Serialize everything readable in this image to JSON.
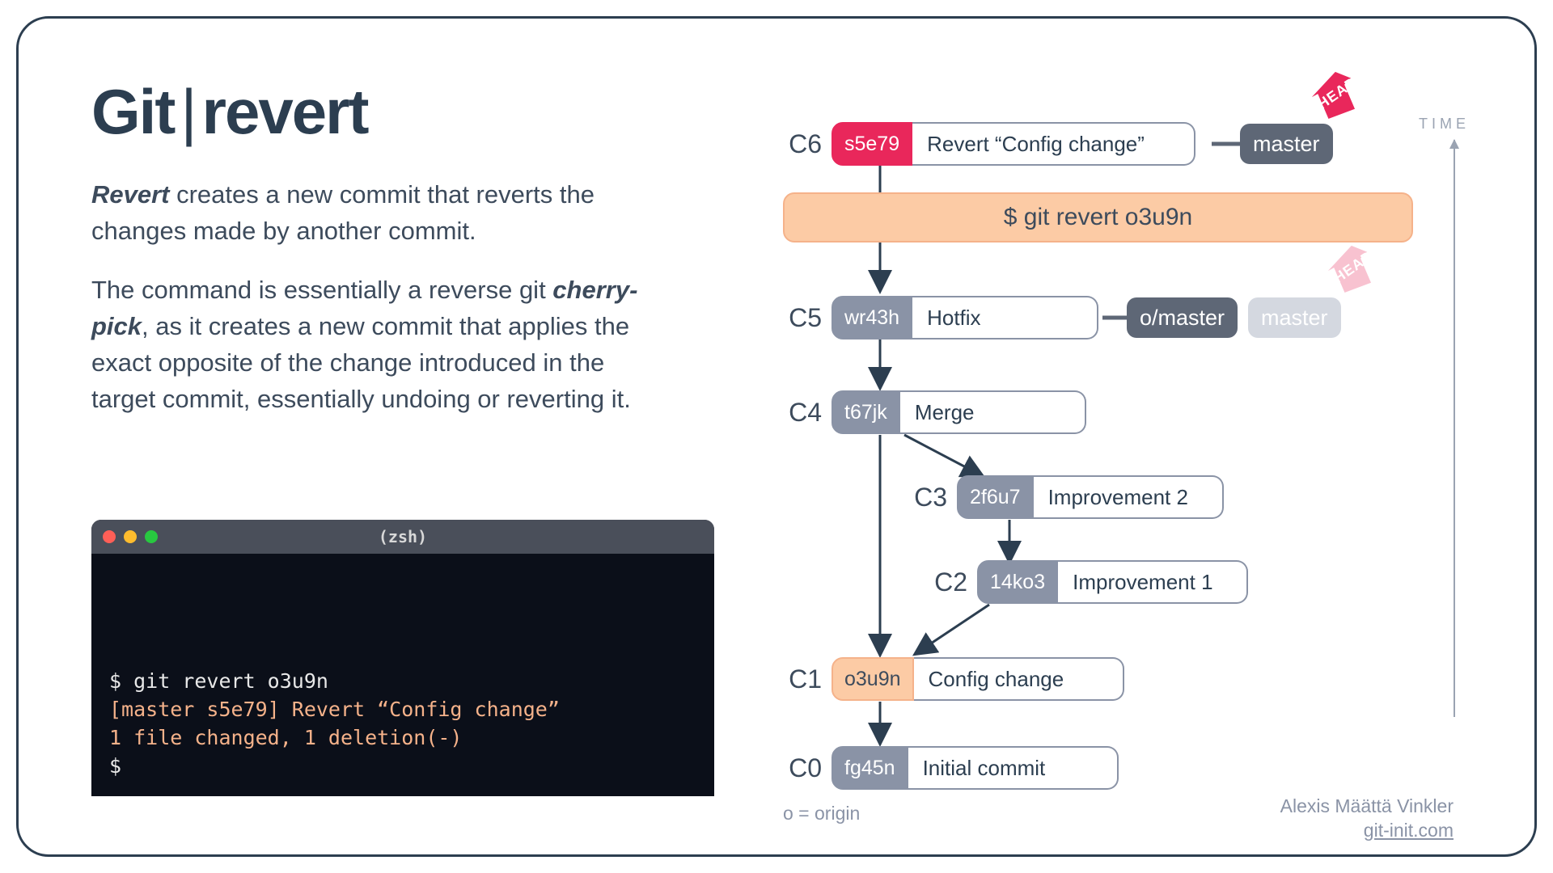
{
  "title_pre": "Git",
  "title_sep": "|",
  "title_post": "revert",
  "desc1_b": "Revert",
  "desc1_rest": " creates a new commit that reverts the changes made by another commit.",
  "desc2_pre": "The command is essentially a reverse git ",
  "desc2_b": "cherry-pick",
  "desc2_rest": ", as it creates a new commit that applies the exact opposite of the change introduced in the target commit, essentially undoing or reverting it.",
  "term_title": "(zsh)",
  "term_l1": "$ git revert o3u9n",
  "term_l2": "[master s5e79] Revert “Config change”",
  "term_l3": "1 file changed, 1 deletion(-)",
  "term_l4": "$",
  "cmd_bar": "$ git revert o3u9n",
  "c6_id": "C6",
  "c6_hash": "s5e79",
  "c6_msg": "Revert “Config change”",
  "c5_id": "C5",
  "c5_hash": "wr43h",
  "c5_msg": "Hotfix",
  "c4_id": "C4",
  "c4_hash": "t67jk",
  "c4_msg": "Merge",
  "c3_id": "C3",
  "c3_hash": "2f6u7",
  "c3_msg": "Improvement 2",
  "c2_id": "C2",
  "c2_hash": "14ko3",
  "c2_msg": "Improvement 1",
  "c1_id": "C1",
  "c1_hash": "o3u9n",
  "c1_msg": "Config change",
  "c0_id": "C0",
  "c0_hash": "fg45n",
  "c0_msg": "Initial commit",
  "ref_master": "master",
  "ref_omaster": "o/master",
  "ref_master_ghost": "master",
  "head": "HEAD",
  "time": "TIME",
  "legend": "o = origin",
  "author": "Alexis Määttä Vinkler",
  "site": "git-init.com"
}
